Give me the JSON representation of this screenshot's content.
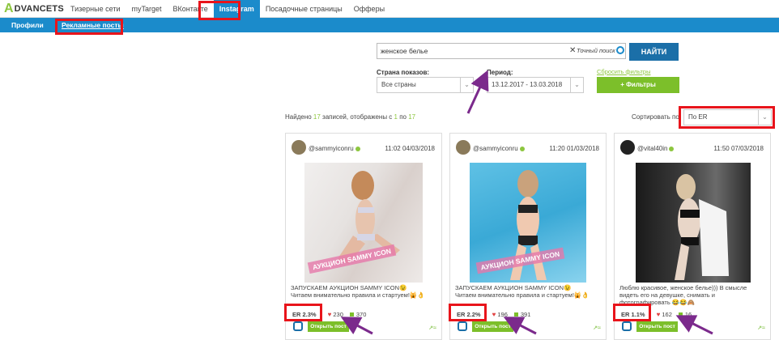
{
  "logo": {
    "mark": "A",
    "word": "DVANCETS"
  },
  "nav": [
    {
      "label": "Тизерные сети"
    },
    {
      "label": "myTarget"
    },
    {
      "label": "ВКонтакте"
    },
    {
      "label": "Instagram"
    },
    {
      "label": "Посадочные страницы"
    },
    {
      "label": "Офферы"
    }
  ],
  "subnav": {
    "profiles": "Профили",
    "ad_posts": "Рекламные посты"
  },
  "search": {
    "value": "женское белье",
    "exact": "Точный поиск",
    "button": "НАЙТИ"
  },
  "filters": {
    "country_label": "Страна показов:",
    "country_value": "Все страны",
    "period_label": "Период:",
    "period_value": "13.12.2017 - 13.03.2018",
    "reset": "Сбросить фильтры",
    "filters_button": "+ Фильтры"
  },
  "found": {
    "pre": "Найдено ",
    "total": "17",
    "mid": " записей, отображены с ",
    "from": "1",
    "to_word": " по ",
    "to": "17"
  },
  "sort": {
    "label": "Сортировать по",
    "value": "По ER"
  },
  "cards": [
    {
      "user": "@sammyiconru",
      "time": "11:02 04/03/2018",
      "watermark": "АУКЦИОН SAMMY ICON",
      "caption1": "ЗАПУСКАЕМ АУКЦИОН SAMMY ICON😉",
      "caption2": "Читаем внимательно правила и стартуем!🙀👌",
      "er": "ER 2.3%",
      "likes": "230",
      "comments": "370",
      "open": "Открыть пост"
    },
    {
      "user": "@sammyiconru",
      "time": "11:20 01/03/2018",
      "watermark": "АУКЦИОН SAMMY ICON",
      "caption1": "ЗАПУСКАЕМ АУКЦИОН SAMMY ICON😉",
      "caption2": "Читаем внимательно правила и стартуем!🙀👌",
      "er": "ER 2.2%",
      "likes": "196",
      "comments": "391",
      "open": "Открыть пост"
    },
    {
      "user": "@vital40in",
      "time": "11:50 07/03/2018",
      "caption1": "Люблю красивое, женское белье))) В смысле",
      "caption2": "видеть его на девушке, снимать и",
      "caption3": "фотографировать 😂😂🙈",
      "er": "ER 1.1%",
      "likes": "162",
      "comments": "16",
      "open": "Открыть пост"
    }
  ],
  "colors": {
    "brand_blue": "#1b8bcb",
    "green": "#7cbf2a",
    "highlight_red": "#e8141b",
    "arrow_purple": "#7b2a8c"
  }
}
